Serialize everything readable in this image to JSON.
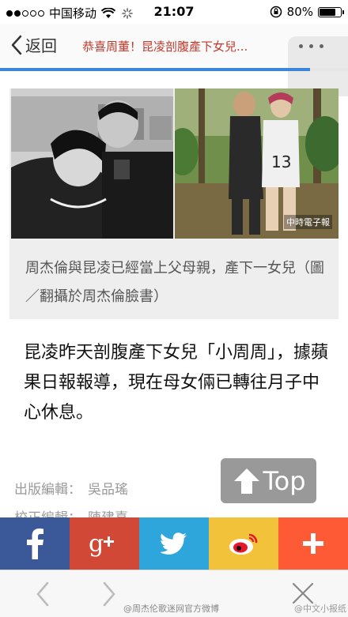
{
  "status_bar": {
    "carrier": "中国移动",
    "time": "21:07",
    "battery": "80%",
    "battery_level": 0.8
  },
  "nav": {
    "back_label": "返回",
    "title": "恭喜周董！昆凌剖腹產下女兒..."
  },
  "article": {
    "photo_watermark": "中時電子報",
    "caption": "周杰倫與昆凌已經當上父母親，產下一女兒（圖／翻攝於周杰倫臉書）",
    "body": "昆凌昨天剖腹產下女兒「小周周」，據蘋果日報報導，現在母女倆已轉往月子中心休息。",
    "credits": [
      {
        "label": "出版編輯：",
        "value": "吳品瑤"
      },
      {
        "label": "校正編輯：",
        "value": "陳建喜"
      }
    ]
  },
  "top_button": {
    "label": "Top"
  },
  "share": {
    "colors": {
      "facebook": "#3b5998",
      "google": "#d14836",
      "twitter": "#2ea6dc",
      "weibo": "#f2c23a",
      "more": "#ff5a36"
    }
  },
  "footer": {
    "watermark": "@周杰伦歌迷网官方微博",
    "watermark2": "@中文小报纸"
  }
}
